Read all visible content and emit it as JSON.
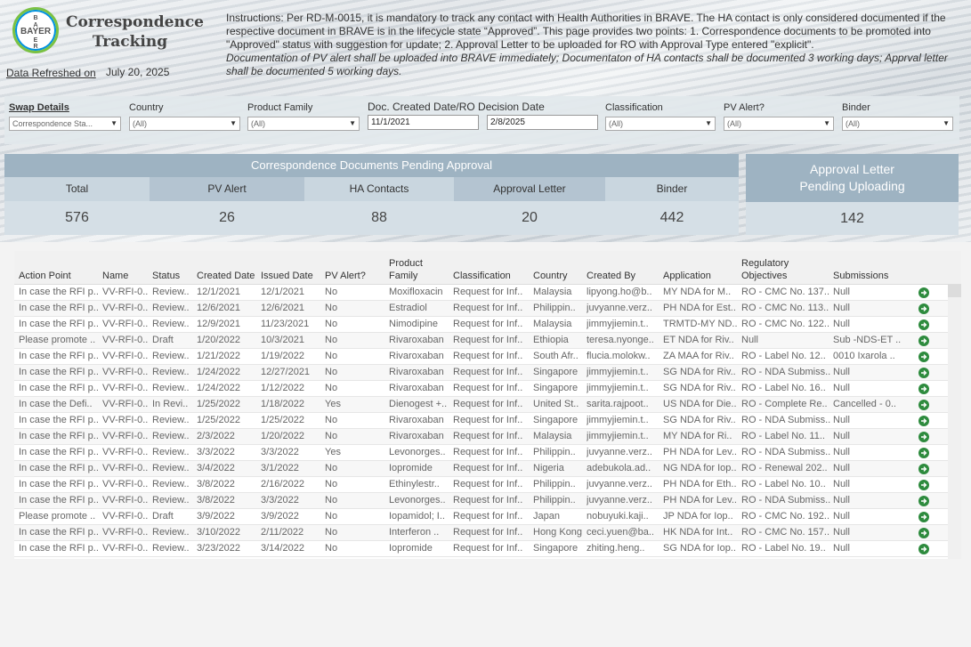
{
  "header": {
    "logo_text": "BAYER",
    "title": "Correspondence Tracking",
    "refresh_label": "Data Refreshed on",
    "refresh_date": "July 20, 2025",
    "instructions": "Instructions: Per RD-M-0015, it is mandatory to track any contact with Health Authorities in BRAVE. The HA contact is only considered documented if the respective document in BRAVE is in the lifecycle state “Approved”. This page provides two points: 1. Correspondence documents to be promoted into \"Approved\" status with suggestion for update; 2. Approval Letter to be uploaded for RO with Approval Type entered \"explicit\".",
    "instructions_note": "Documentation of PV alert shall be uploaded into BRAVE immediately; Documentaton of HA contacts shall be documented 3 working days; Apprval letter shall be documented 5 working days."
  },
  "filters": {
    "swap": {
      "label": "Swap Details",
      "value": "Correspondence Sta..."
    },
    "country": {
      "label": "Country",
      "value": "(All)"
    },
    "product_family": {
      "label": "Product Family",
      "value": "(All)"
    },
    "date": {
      "label": "Doc. Created Date/RO Decision Date",
      "start": "11/1/2021",
      "end": "2/8/2025"
    },
    "classification": {
      "label": "Classification",
      "value": "(All)"
    },
    "pv_alert": {
      "label": "PV Alert?",
      "value": "(All)"
    },
    "binder": {
      "label": "Binder",
      "value": "(All)"
    }
  },
  "kpi": {
    "title": "Correspondence Documents Pending Approval",
    "columns": [
      {
        "label": "Total",
        "value": "576",
        "color": "#c9d6df"
      },
      {
        "label": "PV Alert",
        "value": "26",
        "color": "#b4c4d1"
      },
      {
        "label": "HA Contacts",
        "value": "88",
        "color": "#c9d6df"
      },
      {
        "label": "Approval Letter",
        "value": "20",
        "color": "#b4c4d1"
      },
      {
        "label": "Binder",
        "value": "442",
        "color": "#c9d6df"
      }
    ],
    "side_title_line1": "Approval Letter",
    "side_title_line2": "Pending Uploading",
    "side_value": "142"
  },
  "table": {
    "headers": {
      "action_point": "Action Point",
      "name": "Name",
      "status": "Status",
      "created": "Created Date",
      "issued": "Issued Date",
      "pv_alert": "PV Alert?",
      "product_family_1": "Product",
      "product_family_2": "Family",
      "classification": "Classification",
      "country": "Country",
      "created_by": "Created By",
      "application": "Application",
      "reg_obj_1": "Regulatory",
      "reg_obj_2": "Objectives",
      "submissions": "Submissions"
    },
    "rows": [
      [
        "In case the RFI p..",
        "VV-RFI-0..",
        "Review..",
        "12/1/2021",
        "12/1/2021",
        "No",
        "Moxifloxacin",
        "Request for Inf..",
        "Malaysia",
        "lipyong.ho@b..",
        "MY NDA for M..",
        "RO - CMC No. 137..",
        "Null"
      ],
      [
        "In case the RFI p..",
        "VV-RFI-0..",
        "Review..",
        "12/6/2021",
        "12/6/2021",
        "No",
        "Estradiol",
        "Request for Inf..",
        "Philippin..",
        "juvyanne.verz..",
        "PH NDA for Est..",
        "RO - CMC No. 113..",
        "Null"
      ],
      [
        "In case the RFI p..",
        "VV-RFI-0..",
        "Review..",
        "12/9/2021",
        "11/23/2021",
        "No",
        "Nimodipine",
        "Request for Inf..",
        "Malaysia",
        "jimmyjiemin.t..",
        "TRMTD-MY ND..",
        "RO - CMC No. 122..",
        "Null"
      ],
      [
        "Please promote ..",
        "VV-RFI-0..",
        "Draft",
        "1/20/2022",
        "10/3/2021",
        "No",
        "Rivaroxaban",
        "Request for Inf..",
        "Ethiopia",
        "teresa.nyonge..",
        "ET NDA for Riv..",
        "Null",
        "Sub -NDS-ET .."
      ],
      [
        "In case the RFI p..",
        "VV-RFI-0..",
        "Review..",
        "1/21/2022",
        "1/19/2022",
        "No",
        "Rivaroxaban",
        "Request for Inf..",
        "South Afr..",
        "flucia.molokw..",
        "ZA MAA for Riv..",
        "RO - Label No. 12..",
        "0010 Ixarola .."
      ],
      [
        "In case the RFI p..",
        "VV-RFI-0..",
        "Review..",
        "1/24/2022",
        "12/27/2021",
        "No",
        "Rivaroxaban",
        "Request for Inf..",
        "Singapore",
        "jimmyjiemin.t..",
        "SG NDA for Riv..",
        "RO - NDA Submiss..",
        "Null"
      ],
      [
        "In case the RFI p..",
        "VV-RFI-0..",
        "Review..",
        "1/24/2022",
        "1/12/2022",
        "No",
        "Rivaroxaban",
        "Request for Inf..",
        "Singapore",
        "jimmyjiemin.t..",
        "SG NDA for Riv..",
        "RO - Label No. 16..",
        "Null"
      ],
      [
        "In case the Defi..",
        "VV-RFI-0..",
        "In Revi..",
        "1/25/2022",
        "1/18/2022",
        "Yes",
        "Dienogest +..",
        "Request for Inf..",
        "United St..",
        "sarita.rajpoot..",
        "US NDA for Die..",
        "RO - Complete Re..",
        "Cancelled - 0.."
      ],
      [
        "In case the RFI p..",
        "VV-RFI-0..",
        "Review..",
        "1/25/2022",
        "1/25/2022",
        "No",
        "Rivaroxaban",
        "Request for Inf..",
        "Singapore",
        "jimmyjiemin.t..",
        "SG NDA for Riv..",
        "RO - NDA Submiss..",
        "Null"
      ],
      [
        "In case the RFI p..",
        "VV-RFI-0..",
        "Review..",
        "2/3/2022",
        "1/20/2022",
        "No",
        "Rivaroxaban",
        "Request for Inf..",
        "Malaysia",
        "jimmyjiemin.t..",
        "MY NDA for Ri..",
        "RO - Label No. 11..",
        "Null"
      ],
      [
        "In case the RFI p..",
        "VV-RFI-0..",
        "Review..",
        "3/3/2022",
        "3/3/2022",
        "Yes",
        "Levonorges..",
        "Request for Inf..",
        "Philippin..",
        "juvyanne.verz..",
        "PH NDA for Lev..",
        "RO - NDA Submiss..",
        "Null"
      ],
      [
        "In case the RFI p..",
        "VV-RFI-0..",
        "Review..",
        "3/4/2022",
        "3/1/2022",
        "No",
        "Iopromide",
        "Request for Inf..",
        "Nigeria",
        "adebukola.ad..",
        "NG NDA for Iop..",
        "RO - Renewal 202..",
        "Null"
      ],
      [
        "In case the RFI p..",
        "VV-RFI-0..",
        "Review..",
        "3/8/2022",
        "2/16/2022",
        "No",
        "Ethinylestr..",
        "Request for Inf..",
        "Philippin..",
        "juvyanne.verz..",
        "PH NDA for Eth..",
        "RO - Label No. 10..",
        "Null"
      ],
      [
        "In case the RFI p..",
        "VV-RFI-0..",
        "Review..",
        "3/8/2022",
        "3/3/2022",
        "No",
        "Levonorges..",
        "Request for Inf..",
        "Philippin..",
        "juvyanne.verz..",
        "PH NDA for Lev..",
        "RO - NDA Submiss..",
        "Null"
      ],
      [
        "Please promote ..",
        "VV-RFI-0..",
        "Draft",
        "3/9/2022",
        "3/9/2022",
        "No",
        "Iopamidol; I..",
        "Request for Inf..",
        "Japan",
        "nobuyuki.kaji..",
        "JP NDA for Iop..",
        "RO - CMC No. 192..",
        "Null"
      ],
      [
        "In case the RFI p..",
        "VV-RFI-0..",
        "Review..",
        "3/10/2022",
        "2/11/2022",
        "No",
        "Interferon ..",
        "Request for Inf..",
        "Hong Kong",
        "ceci.yuen@ba..",
        "HK NDA for Int..",
        "RO - CMC No. 157..",
        "Null"
      ],
      [
        "In case the RFI p..",
        "VV-RFI-0..",
        "Review..",
        "3/23/2022",
        "3/14/2022",
        "No",
        "Iopromide",
        "Request for Inf..",
        "Singapore",
        "zhiting.heng..",
        "SG NDA for Iop..",
        "RO - Label No. 19..",
        "Null"
      ]
    ]
  },
  "colors": {
    "kpi_header": "#9eb3c2",
    "go_icon": "#2e8b3e",
    "logo_green": "#7ac143",
    "logo_blue": "#0091df"
  }
}
